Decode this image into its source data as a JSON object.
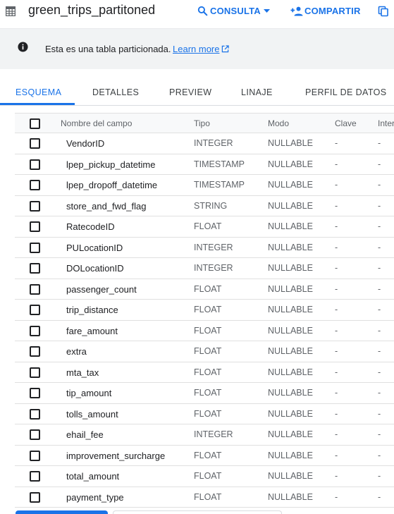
{
  "header": {
    "title": "green_trips_partitoned",
    "consulta_label": "CONSULTA",
    "compartir_label": "COMPARTIR",
    "icons": [
      "table-icon",
      "search-icon",
      "chevron-down-icon",
      "person-add-icon",
      "copy-icon"
    ]
  },
  "banner": {
    "message": "Esta es una tabla particionada.",
    "link_label": "Learn more",
    "icons": [
      "info-icon",
      "open-in-new-icon"
    ]
  },
  "tabs": [
    {
      "label": "ESQUEMA",
      "active": true
    },
    {
      "label": "DETALLES",
      "active": false
    },
    {
      "label": "PREVIEW",
      "active": false
    },
    {
      "label": "LINAJE",
      "active": false
    },
    {
      "label": "PERFIL DE DATOS",
      "active": false
    }
  ],
  "schema": {
    "columns": {
      "name": "Nombre del campo",
      "type": "Tipo",
      "mode": "Modo",
      "key": "Clave",
      "interval": "Inter"
    },
    "rows": [
      {
        "name": "VendorID",
        "type": "INTEGER",
        "mode": "NULLABLE",
        "key": "-",
        "interval": "-"
      },
      {
        "name": "lpep_pickup_datetime",
        "type": "TIMESTAMP",
        "mode": "NULLABLE",
        "key": "-",
        "interval": "-"
      },
      {
        "name": "lpep_dropoff_datetime",
        "type": "TIMESTAMP",
        "mode": "NULLABLE",
        "key": "-",
        "interval": "-"
      },
      {
        "name": "store_and_fwd_flag",
        "type": "STRING",
        "mode": "NULLABLE",
        "key": "-",
        "interval": "-"
      },
      {
        "name": "RatecodeID",
        "type": "FLOAT",
        "mode": "NULLABLE",
        "key": "-",
        "interval": "-"
      },
      {
        "name": "PULocationID",
        "type": "INTEGER",
        "mode": "NULLABLE",
        "key": "-",
        "interval": "-"
      },
      {
        "name": "DOLocationID",
        "type": "INTEGER",
        "mode": "NULLABLE",
        "key": "-",
        "interval": "-"
      },
      {
        "name": "passenger_count",
        "type": "FLOAT",
        "mode": "NULLABLE",
        "key": "-",
        "interval": "-"
      },
      {
        "name": "trip_distance",
        "type": "FLOAT",
        "mode": "NULLABLE",
        "key": "-",
        "interval": "-"
      },
      {
        "name": "fare_amount",
        "type": "FLOAT",
        "mode": "NULLABLE",
        "key": "-",
        "interval": "-"
      },
      {
        "name": "extra",
        "type": "FLOAT",
        "mode": "NULLABLE",
        "key": "-",
        "interval": "-"
      },
      {
        "name": "mta_tax",
        "type": "FLOAT",
        "mode": "NULLABLE",
        "key": "-",
        "interval": "-"
      },
      {
        "name": "tip_amount",
        "type": "FLOAT",
        "mode": "NULLABLE",
        "key": "-",
        "interval": "-"
      },
      {
        "name": "tolls_amount",
        "type": "FLOAT",
        "mode": "NULLABLE",
        "key": "-",
        "interval": "-"
      },
      {
        "name": "ehail_fee",
        "type": "INTEGER",
        "mode": "NULLABLE",
        "key": "-",
        "interval": "-"
      },
      {
        "name": "improvement_surcharge",
        "type": "FLOAT",
        "mode": "NULLABLE",
        "key": "-",
        "interval": "-"
      },
      {
        "name": "total_amount",
        "type": "FLOAT",
        "mode": "NULLABLE",
        "key": "-",
        "interval": "-"
      },
      {
        "name": "payment_type",
        "type": "FLOAT",
        "mode": "NULLABLE",
        "key": "-",
        "interval": "-"
      }
    ]
  },
  "colors": {
    "accent": "#1a73e8",
    "banner_bg": "#f1f3f4",
    "text_secondary": "#5f6368"
  }
}
